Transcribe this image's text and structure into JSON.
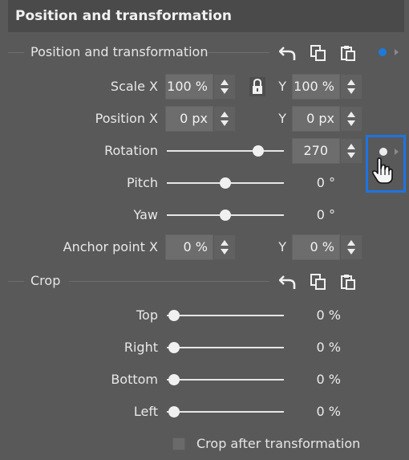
{
  "header": {
    "title": "Position and transformation"
  },
  "pos_section": {
    "title": "Position and transformation",
    "icons": [
      "undo-icon",
      "copy-icon",
      "paste-icon"
    ],
    "keyframe_color": "#1e7ad8"
  },
  "scale": {
    "label": "Scale X",
    "x_value": "100 %",
    "y_label": "Y",
    "y_value": "100 %"
  },
  "position": {
    "label": "Position X",
    "x_value": "0 px",
    "y_label": "Y",
    "y_value": "0 px"
  },
  "rotation": {
    "label": "Rotation",
    "value": "270",
    "slider_fraction": 0.82
  },
  "pitch": {
    "label": "Pitch",
    "value": "0 °",
    "slider_fraction": 0.5
  },
  "yaw": {
    "label": "Yaw",
    "value": "0 °",
    "slider_fraction": 0.5
  },
  "anchor": {
    "label": "Anchor point X",
    "x_value": "0 %",
    "y_label": "Y",
    "y_value": "0 %"
  },
  "crop_section": {
    "title": "Crop",
    "icons": [
      "undo-icon",
      "copy-icon",
      "paste-icon"
    ]
  },
  "crop": {
    "top": {
      "label": "Top",
      "value": "0 %",
      "slider_fraction": 0.0
    },
    "right": {
      "label": "Right",
      "value": "0 %",
      "slider_fraction": 0.0
    },
    "bottom": {
      "label": "Bottom",
      "value": "0 %",
      "slider_fraction": 0.0
    },
    "left": {
      "label": "Left",
      "value": "0 %",
      "slider_fraction": 0.0
    }
  },
  "crop_after": {
    "label": "Crop after transformation",
    "checked": false
  },
  "colors": {
    "accent": "#1e74e0",
    "background": "#595959"
  }
}
